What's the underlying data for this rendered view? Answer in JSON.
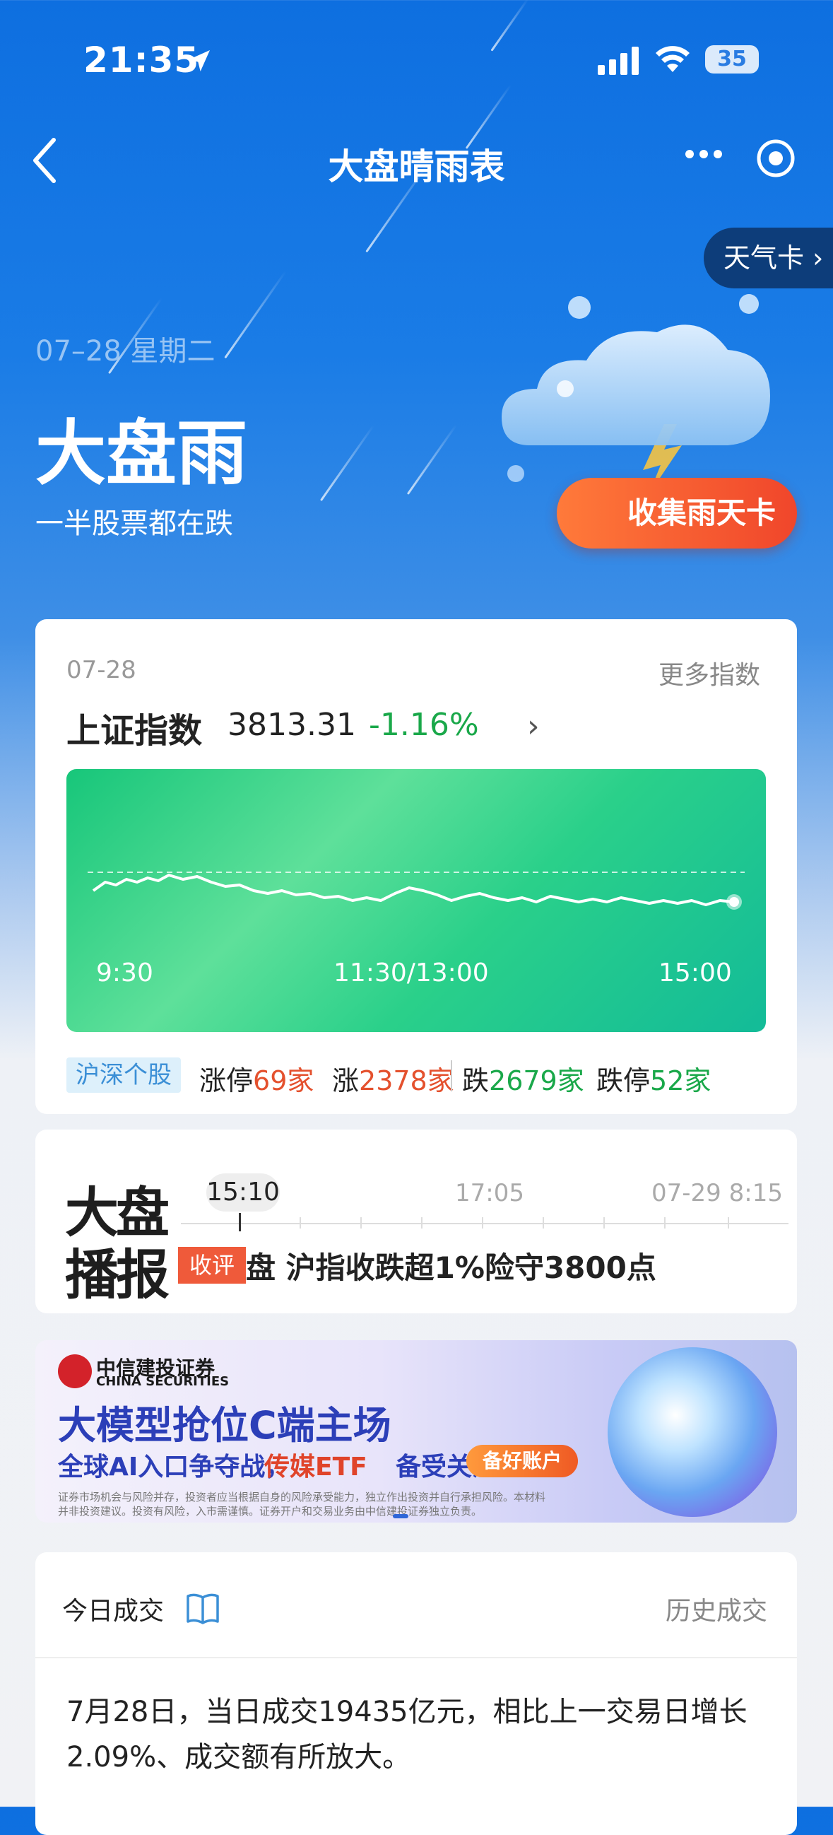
{
  "status_bar": {
    "time": "21:35",
    "battery": "35"
  },
  "nav": {
    "title": "大盘晴雨表"
  },
  "weather_card_tab": "天气卡 ›",
  "hero": {
    "date": "07–28 星期二",
    "weather": "大盘雨",
    "description": "一半股票都在跌",
    "collect_button": "收集雨天卡"
  },
  "index_card": {
    "date": "07-28",
    "more": "更多指数",
    "name": "上证指数",
    "value": "3813.31",
    "change": "-1.16%",
    "arrow": "›",
    "chart_labels": {
      "open": "9:30",
      "mid": "11:30/13:00",
      "close": "15:00"
    },
    "stats": {
      "tag": "沪深个股",
      "limit_up_label": "涨停",
      "limit_up_value": "69家",
      "up_label": "涨",
      "up_value": "2378家",
      "down_label": "跌",
      "down_value": "2679家",
      "limit_down_label": "跌停",
      "limit_down_value": "52家"
    }
  },
  "broadcast": {
    "logo_line1": "大盘",
    "logo_line2": "播报",
    "active_time": "15:10",
    "time2": "17:05",
    "time3": "07-29 8:15",
    "tag": "收评",
    "headline": "盘 沪指收跌超1%险守3800点"
  },
  "ad": {
    "brand": "中信建投证券",
    "brand_en": "CHINA SECURITIES",
    "title": "大模型抢位C端主场",
    "sub1": "全球AI入口争夺战，",
    "sub2": "传媒ETF",
    "sub3": "备受关注",
    "button": "备好账户",
    "disclaimer": "证券市场机会与风险并存，投资者应当根据自身的风险承受能力，独立作出投资并自行承担风险。本材料并非投资建议。投资有风险，入市需谨慎。证券开户和交易业务由中信建投证券独立负责。"
  },
  "volume": {
    "title": "今日成交",
    "history": "历史成交",
    "text": "7月28日，当日成交19435亿元，相比上一交易日增长2.09%、成交额有所放大。"
  },
  "colors": {
    "up": "#e4512e",
    "down": "#1aa84a",
    "brand_blue": "#1a7ce6"
  }
}
